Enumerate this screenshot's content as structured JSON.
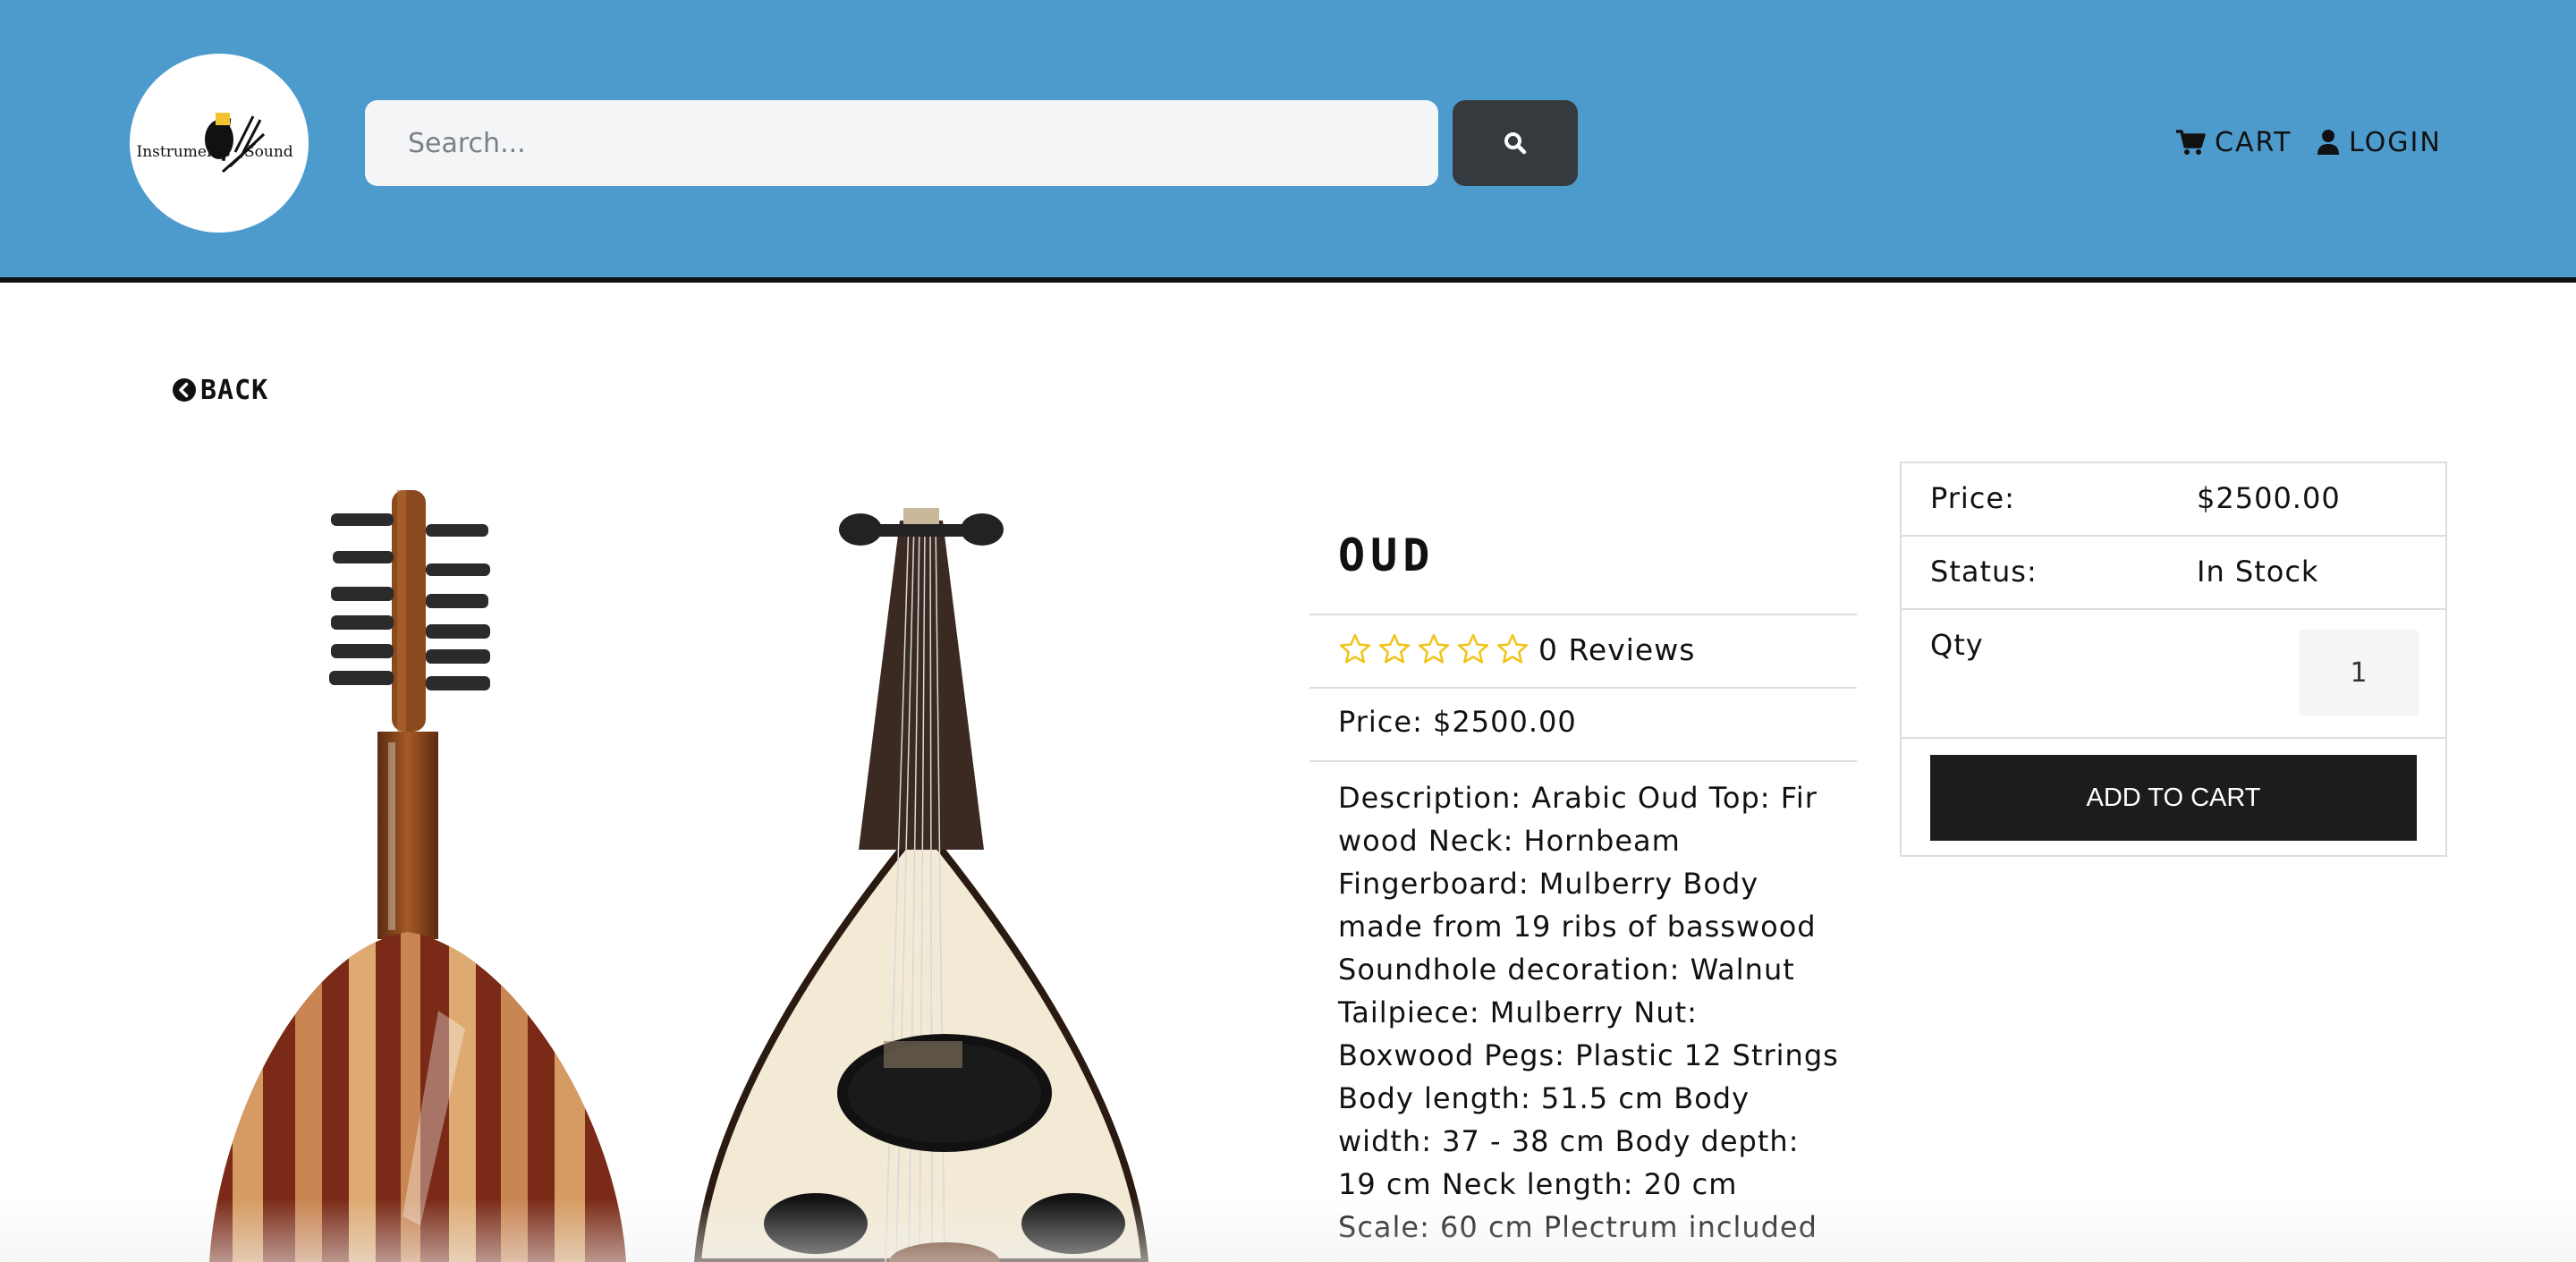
{
  "header": {
    "logo": {
      "text_left": "Instruments",
      "text_right": "Sound",
      "icon": "guitar-logo-icon"
    },
    "search": {
      "placeholder": "Search...",
      "value": "",
      "button_icon": "search-icon"
    },
    "nav": {
      "cart_label": "CART",
      "cart_icon": "cart-icon",
      "login_label": "LOGIN",
      "login_icon": "user-icon"
    }
  },
  "main": {
    "back_label": "BACK",
    "back_icon": "chevron-left-circle-icon",
    "product": {
      "name": "OUD",
      "image_alt": "Oud back and front view",
      "rating_stars": 0,
      "reviews_label": "0 Reviews",
      "price_label": "Price: $2500.00",
      "description": "Description: Arabic Oud Top: Fir wood Neck: Hornbeam Fingerboard: Mulberry Body made from 19 ribs of basswood Soundhole decoration: Walnut Tailpiece: Mulberry Nut: Boxwood Pegs: Plastic 12 Strings Body length: 51.5 cm Body width: 37 - 38 cm Body depth: 19 cm Neck length: 20 cm Scale: 60 cm Plectrum included"
    },
    "purchase": {
      "price_label": "Price:",
      "price_value": "$2500.00",
      "status_label": "Status:",
      "status_value": "In Stock",
      "qty_label": "Qty",
      "qty_value": "1",
      "add_to_cart_label": "ADD TO CART"
    }
  },
  "colors": {
    "header_bg": "#4d9bcd",
    "search_button_bg": "#353a3f",
    "add_to_cart_bg": "#1c1c1c",
    "star_color": "#f0c419"
  }
}
